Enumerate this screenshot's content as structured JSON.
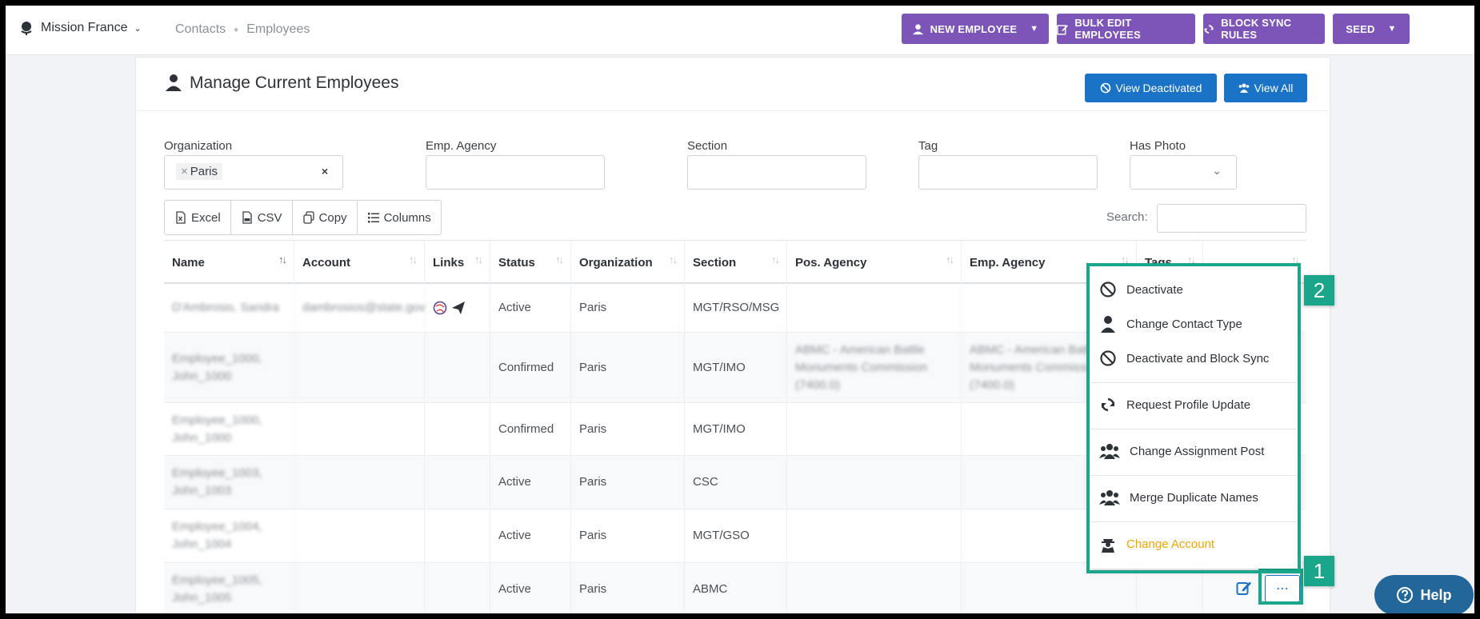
{
  "app": {
    "mission": "Mission France",
    "breadcrumbs": [
      "Contacts",
      "Employees"
    ]
  },
  "topbar": {
    "new_employee": "NEW EMPLOYEE",
    "bulk_edit": "BULK EDIT EMPLOYEES",
    "block_sync": "BLOCK SYNC RULES",
    "seed": "SEED"
  },
  "card": {
    "title": "Manage Current Employees",
    "view_deactivated": "View Deactivated",
    "view_all": "View All"
  },
  "filters": {
    "organization_label": "Organization",
    "organization_chip": "Paris",
    "emp_agency_label": "Emp. Agency",
    "section_label": "Section",
    "tag_label": "Tag",
    "has_photo_label": "Has Photo"
  },
  "toolbar": {
    "excel": "Excel",
    "csv": "CSV",
    "copy": "Copy",
    "columns": "Columns",
    "search_label": "Search:"
  },
  "table": {
    "columns": [
      "Name",
      "Account",
      "Links",
      "Status",
      "Organization",
      "Section",
      "Pos. Agency",
      "Emp. Agency",
      "Tags",
      ""
    ],
    "rows": [
      {
        "name": "D'Ambrosio, Sandra",
        "account": "dambrosios@state.gov",
        "status": "Active",
        "org": "Paris",
        "section": "MGT/RSO/MSG",
        "pos_agency": "",
        "emp_agency": ""
      },
      {
        "name": "Employee_1000, John_1000",
        "account": "",
        "status": "Confirmed",
        "org": "Paris",
        "section": "MGT/IMO",
        "pos_agency": "ABMC - American Battle Monuments Commission (7400.0)",
        "emp_agency": "ABMC - American Battle Monuments Commission (7400.0)"
      },
      {
        "name": "Employee_1000, John_1000",
        "account": "",
        "status": "Confirmed",
        "org": "Paris",
        "section": "MGT/IMO",
        "pos_agency": "",
        "emp_agency": ""
      },
      {
        "name": "Employee_1003, John_1003",
        "account": "",
        "status": "Active",
        "org": "Paris",
        "section": "CSC",
        "pos_agency": "",
        "emp_agency": ""
      },
      {
        "name": "Employee_1004, John_1004",
        "account": "",
        "status": "Active",
        "org": "Paris",
        "section": "MGT/GSO",
        "pos_agency": "",
        "emp_agency": ""
      },
      {
        "name": "Employee_1005, John_1005",
        "account": "",
        "status": "Active",
        "org": "Paris",
        "section": "ABMC",
        "pos_agency": "",
        "emp_agency": ""
      }
    ]
  },
  "menu": {
    "items": [
      "Deactivate",
      "Change Contact Type",
      "Deactivate and Block Sync",
      "Request Profile Update",
      "Change Assignment Post",
      "Merge Duplicate Names",
      "Change Account"
    ]
  },
  "annotations": {
    "badge1": "1",
    "badge2": "2"
  },
  "help": {
    "label": "Help"
  },
  "colors": {
    "purple": "#7d55b8",
    "blue": "#1a73c7",
    "teal": "#19a68a",
    "warn": "#f0a500"
  }
}
